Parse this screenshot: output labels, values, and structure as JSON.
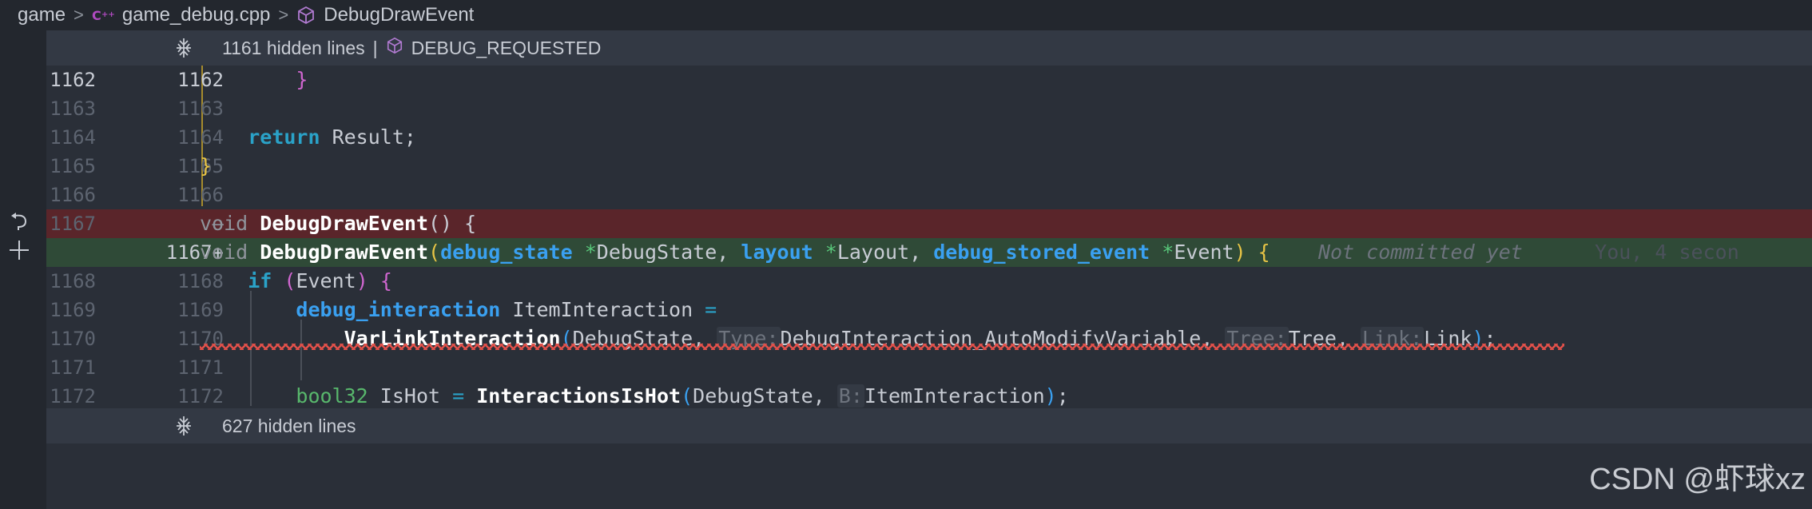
{
  "breadcrumb": {
    "items": [
      "game",
      "game_debug.cpp",
      "DebugDrawEvent"
    ],
    "separator": ">"
  },
  "folds": [
    {
      "text": "1161 hidden lines",
      "separator": "|",
      "symbol": "DEBUG_REQUESTED"
    },
    {
      "text": "627 hidden lines"
    }
  ],
  "lines": {
    "l1162": {
      "left": "1162",
      "right": "1162",
      "code": "}"
    },
    "l1163": {
      "left": "1163",
      "right": "1163"
    },
    "l1164": {
      "left": "1164",
      "right": "1164",
      "kw": "return",
      "rest": " Result;"
    },
    "l1165": {
      "left": "1165",
      "right": "1165",
      "code": "}"
    },
    "l1166": {
      "left": "1166",
      "right": "1166"
    },
    "l1167_old": {
      "left": "1167",
      "marker": "—",
      "kw": "void",
      "fn": "DebugDrawEvent",
      "rest": "() {"
    },
    "l1167_new": {
      "right": "1167",
      "marker": "+",
      "kw": "void",
      "fn": "DebugDrawEvent",
      "t1": "debug_state",
      "p1": "*",
      "a1": "DebugState, ",
      "t2": "layout",
      "p2": "*",
      "a2": "Layout, ",
      "t3": "debug_stored_event",
      "p3": "*",
      "a3": "Event",
      "blame": "Not committed yet",
      "blame_author": "You, 4 secon"
    },
    "l1168": {
      "left": "1168",
      "right": "1168",
      "kw": "if",
      "arg": "Event"
    },
    "l1169": {
      "left": "1169",
      "right": "1169",
      "type": "debug_interaction",
      "rest": " ItemInteraction ",
      "op": "="
    },
    "l1170": {
      "left": "1170",
      "right": "1170",
      "fn": "VarLinkInteraction",
      "a0": "DebugState, ",
      "h1": "Type:",
      "a1": "DebugInteraction_AutoModifyVariable, ",
      "h2": "Tree:",
      "a2": "Tree, ",
      "h3": "Link:",
      "a3": "Link"
    },
    "l1171": {
      "left": "1171",
      "right": "1171"
    },
    "l1172": {
      "left": "1172",
      "right": "1172",
      "type": "bool32",
      "rest": " IsHot ",
      "op": "=",
      "fn": "InteractionsIsHot",
      "a0": "DebugState, ",
      "h1": "B:",
      "a1": "ItemInteraction"
    }
  },
  "watermark": "CSDN @虾球xz",
  "colors": {
    "background": "#23272e",
    "editor": "#2a2f38",
    "fold": "#333944",
    "deleted": "#5a252a",
    "added": "#2f4a37",
    "keyword": "#2aa2c8",
    "type": "#3aa0f0"
  },
  "icons": [
    "cpp-file-icon",
    "symbol-cube-icon",
    "unfold-icon",
    "revert-icon",
    "add-icon"
  ]
}
